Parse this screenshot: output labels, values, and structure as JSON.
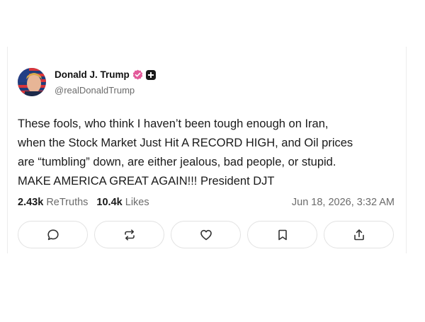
{
  "post": {
    "author_name": "Donald J. Trump",
    "handle": "@realDonaldTrump",
    "body_lines": [
      "These fools, who think I haven’t been tough enough on Iran,",
      "when the Stock Market Just Hit A RECORD HIGH, and Oil prices",
      "are “tumbling” down, are either jealous, bad people, or stupid.",
      "MAKE AMERICA GREAT AGAIN!!! President DJT"
    ],
    "retruths_count": "2.43k",
    "retruths_label": "ReTruths",
    "likes_count": "10.4k",
    "likes_label": "Likes",
    "timestamp": "Jun 18, 2026, 3:32 AM"
  },
  "icons": {
    "verified": "verified-badge-icon",
    "plus": "plus-icon",
    "reply": "chat-bubble-icon",
    "retruth": "repost-icon",
    "like": "heart-icon",
    "bookmark": "bookmark-icon",
    "share": "share-icon"
  },
  "colors": {
    "verified_badge": "#e35a9a",
    "text_primary": "#111111",
    "text_secondary": "#6b6b6b",
    "button_border": "#e2e2e2"
  }
}
